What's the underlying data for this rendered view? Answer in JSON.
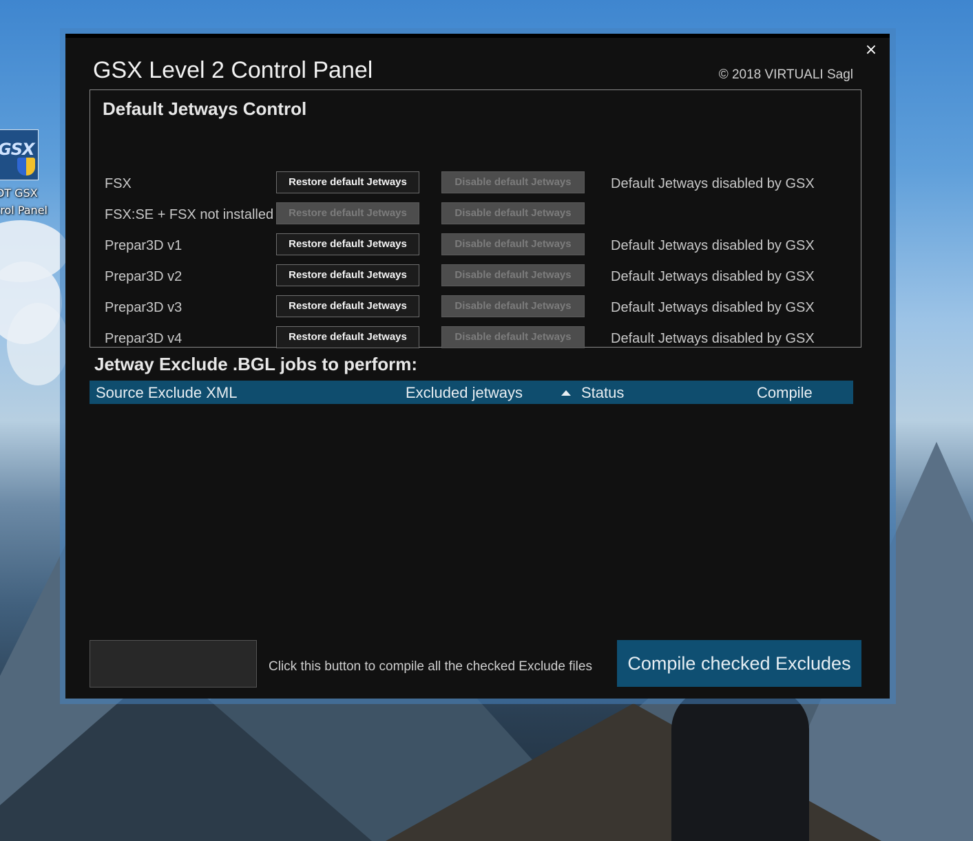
{
  "desktop": {
    "shortcut": {
      "icon_name": "gsx-shortcut-icon",
      "label": "DT GSX\ntrol Panel"
    }
  },
  "window": {
    "title": "GSX Level 2 Control Panel",
    "copyright": "© 2018 VIRTUALI Sagl",
    "close_label": "×"
  },
  "jetway_panel": {
    "title": "Default Jetways Control",
    "restore_label": "Restore default Jetways",
    "disable_label": "Disable default Jetways",
    "rows": [
      {
        "sim": "FSX",
        "restore_enabled": true,
        "status": "Default Jetways disabled by GSX"
      },
      {
        "sim": "FSX:SE + FSX not installed",
        "restore_enabled": false,
        "status": ""
      },
      {
        "sim": "Prepar3D v1",
        "restore_enabled": true,
        "status": "Default Jetways disabled by GSX"
      },
      {
        "sim": "Prepar3D v2",
        "restore_enabled": true,
        "status": "Default Jetways disabled by GSX"
      },
      {
        "sim": "Prepar3D v3",
        "restore_enabled": true,
        "status": "Default Jetways disabled by GSX"
      },
      {
        "sim": "Prepar3D v4",
        "restore_enabled": true,
        "status": "Default Jetways disabled by GSX"
      }
    ]
  },
  "jobs": {
    "title": "Jetway Exclude .BGL jobs to perform:",
    "columns": {
      "source": "Source Exclude XML",
      "excluded": "Excluded jetways",
      "status": "Status",
      "compile": "Compile"
    },
    "rows": []
  },
  "footer": {
    "hint": "Click this button to compile all the checked Exclude files",
    "compile_button": "Compile checked Excludes"
  },
  "colors": {
    "accent": "#0f4f72",
    "window_bg": "#111111"
  }
}
